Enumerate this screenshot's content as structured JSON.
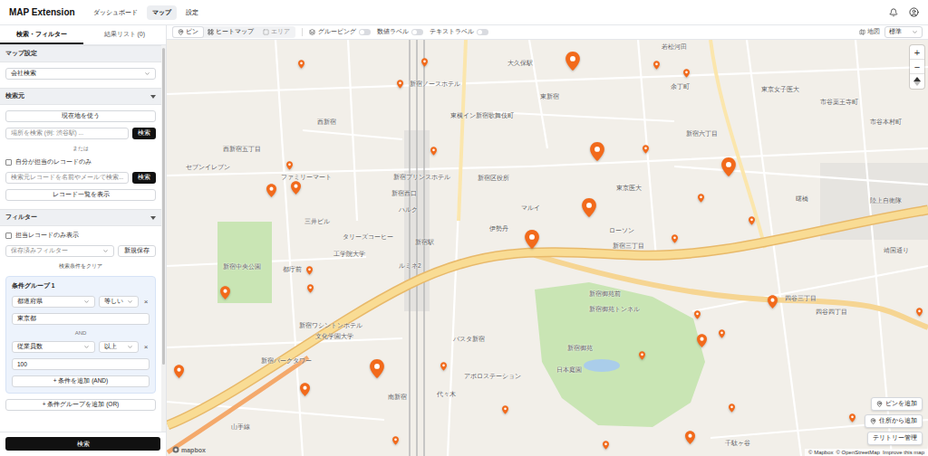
{
  "header": {
    "logo": "MAP Extension",
    "nav": [
      {
        "label": "ダッシュボード",
        "selected": false
      },
      {
        "label": "マップ",
        "selected": true
      },
      {
        "label": "設定",
        "selected": false
      }
    ]
  },
  "sidebar": {
    "tabs": [
      {
        "label": "検索・フィルター",
        "selected": true
      },
      {
        "label": "結果リスト (0)",
        "selected": false
      }
    ],
    "map_settings": {
      "title": "マップ設定",
      "select": "会社検索"
    },
    "source": {
      "title": "検索元",
      "expanded": true,
      "current_location_button": "現在地を使う",
      "place_search": {
        "placeholder": "場所を検索 (例: 渋谷駅) ...",
        "button": "検索"
      },
      "or": "または",
      "mine_only": {
        "label": "自分が担当のレコードのみ",
        "checked": false
      },
      "record_search": {
        "placeholder": "検索元レコードを名前やメールで検索...",
        "button": "検索"
      },
      "list_button": "レコード一覧を表示"
    },
    "filter": {
      "title": "フィルター",
      "expanded": true,
      "assigned_only": {
        "label": "担当レコードのみ表示",
        "checked": false
      },
      "saved_filter": "保存済みフィルター",
      "save_button": "新規保存",
      "clear_link": "検索条件をクリア",
      "groups": [
        {
          "title": "条件グループ 1",
          "joiner": "AND",
          "add_condition": "+ 条件を追加 (AND)",
          "conditions": [
            {
              "field": "都道府県",
              "operator": "等しい",
              "value": "東京都",
              "remove": "×"
            },
            {
              "field": "従業員数",
              "operator": "以上",
              "value": "100",
              "remove": "×"
            }
          ]
        }
      ],
      "add_group": "+ 条件グループを追加 (OR)"
    },
    "search_button": "検索"
  },
  "map_toolbar": {
    "modes": [
      {
        "label": "ピン",
        "selected": true,
        "disabled": false
      },
      {
        "label": "ヒートマップ",
        "selected": false,
        "disabled": false
      },
      {
        "label": "エリア",
        "selected": false,
        "disabled": true
      }
    ],
    "toggles": [
      {
        "label": "グルーピング",
        "on": false
      },
      {
        "label": "数値ラベル",
        "on": false
      },
      {
        "label": "テキストラベル",
        "on": false
      }
    ],
    "basemap": {
      "label": "地図",
      "value": "標準"
    }
  },
  "map": {
    "labels": [
      "大久保駅",
      "新宿ノースホテル",
      "東新宿",
      "東横イン新宿歌舞伎町",
      "西新宿五丁目",
      "西新宿",
      "新宿プリンスホテル",
      "新宿西口",
      "新宿区役所",
      "ファミリーマート",
      "セブンイレブン",
      "三井ビル",
      "ハルク",
      "マルイ",
      "伊勢丹",
      "東京医大",
      "新宿中央公園",
      "都庁前",
      "工学院大学",
      "タリーズコーヒー",
      "新宿駅",
      "ルミネ2",
      "新宿三丁目",
      "新宿御苑前",
      "新宿御苑トンネル",
      "新宿御苑",
      "日本庭園",
      "新宿ワシントンホテル",
      "文化学園大学",
      "新宿パークタワー",
      "バスタ新宿",
      "アポロステーション",
      "南新宿",
      "代々木",
      "若松河田",
      "余丁町",
      "東京女子医大",
      "市谷薬王寺町",
      "曙橋",
      "陸上自衛隊",
      "四谷三丁目",
      "四谷四丁目",
      "靖国通り",
      "市谷本村町",
      "ローソン",
      "新宿六丁目",
      "山手線",
      "千駄ヶ谷"
    ],
    "pins": [
      {
        "kind": "large"
      },
      {
        "kind": "large"
      },
      {
        "kind": "large"
      },
      {
        "kind": "large"
      },
      {
        "kind": "large"
      },
      {
        "kind": "large"
      },
      {
        "kind": "medium"
      },
      {
        "kind": "medium"
      },
      {
        "kind": "medium"
      },
      {
        "kind": "medium"
      },
      {
        "kind": "medium"
      },
      {
        "kind": "medium"
      },
      {
        "kind": "medium"
      },
      {
        "kind": "medium"
      },
      {
        "kind": "small"
      },
      {
        "kind": "small"
      },
      {
        "kind": "small"
      },
      {
        "kind": "small"
      },
      {
        "kind": "small"
      },
      {
        "kind": "small"
      },
      {
        "kind": "small"
      },
      {
        "kind": "small"
      },
      {
        "kind": "small"
      },
      {
        "kind": "small"
      },
      {
        "kind": "small"
      },
      {
        "kind": "small"
      },
      {
        "kind": "small"
      },
      {
        "kind": "small"
      },
      {
        "kind": "small"
      },
      {
        "kind": "small"
      },
      {
        "kind": "small"
      },
      {
        "kind": "small"
      },
      {
        "kind": "small"
      },
      {
        "kind": "small"
      },
      {
        "kind": "small"
      },
      {
        "kind": "small"
      },
      {
        "kind": "small"
      }
    ],
    "zoom": {
      "in": "+",
      "out": "−"
    },
    "actions": [
      "ピンを追加",
      "住所から追加",
      "テリトリー管理"
    ],
    "logo": "mapbox",
    "attribution": [
      "© Mapbox",
      "© OpenStreetMap",
      "Improve this map"
    ]
  }
}
